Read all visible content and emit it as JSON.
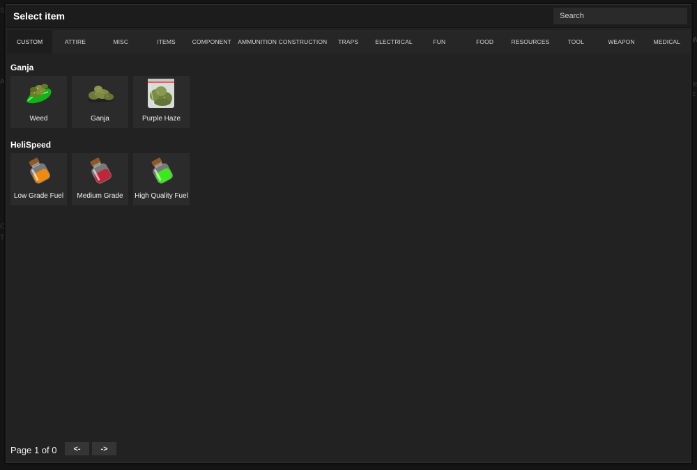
{
  "window": {
    "title": "Select item",
    "search_placeholder": "Search"
  },
  "tabs": [
    {
      "label": "CUSTOM",
      "active": true
    },
    {
      "label": "ATTIRE"
    },
    {
      "label": "MISC"
    },
    {
      "label": "ITEMS"
    },
    {
      "label": "COMPONENT"
    },
    {
      "label": "AMMUNITION"
    },
    {
      "label": "CONSTRUCTION"
    },
    {
      "label": "TRAPS"
    },
    {
      "label": "ELECTRICAL"
    },
    {
      "label": "FUN"
    },
    {
      "label": "FOOD"
    },
    {
      "label": "RESOURCES"
    },
    {
      "label": "TOOL"
    },
    {
      "label": "WEAPON"
    },
    {
      "label": "MEDICAL"
    }
  ],
  "sections": [
    {
      "title": "Ganja",
      "items": [
        {
          "label": "Weed",
          "icon": "weed-bud-icon"
        },
        {
          "label": "Ganja",
          "icon": "ganja-bud-icon"
        },
        {
          "label": "Purple Haze",
          "icon": "bagged-weed-icon"
        }
      ]
    },
    {
      "title": "HeliSpeed",
      "items": [
        {
          "label": "Low Grade Fuel",
          "icon": "orange-potion-jar-icon"
        },
        {
          "label": "Medium Grade",
          "icon": "red-potion-jar-icon"
        },
        {
          "label": "High Quality Fuel",
          "icon": "green-potion-jar-icon"
        }
      ]
    }
  ],
  "pagination": {
    "page_text": "Page 1 of 0",
    "prev_label": "<-",
    "next_label": "->"
  },
  "colors": {
    "panel_bg": "#222222",
    "tab_bar_bg": "#262626",
    "card_bg": "#2b2b2b"
  }
}
